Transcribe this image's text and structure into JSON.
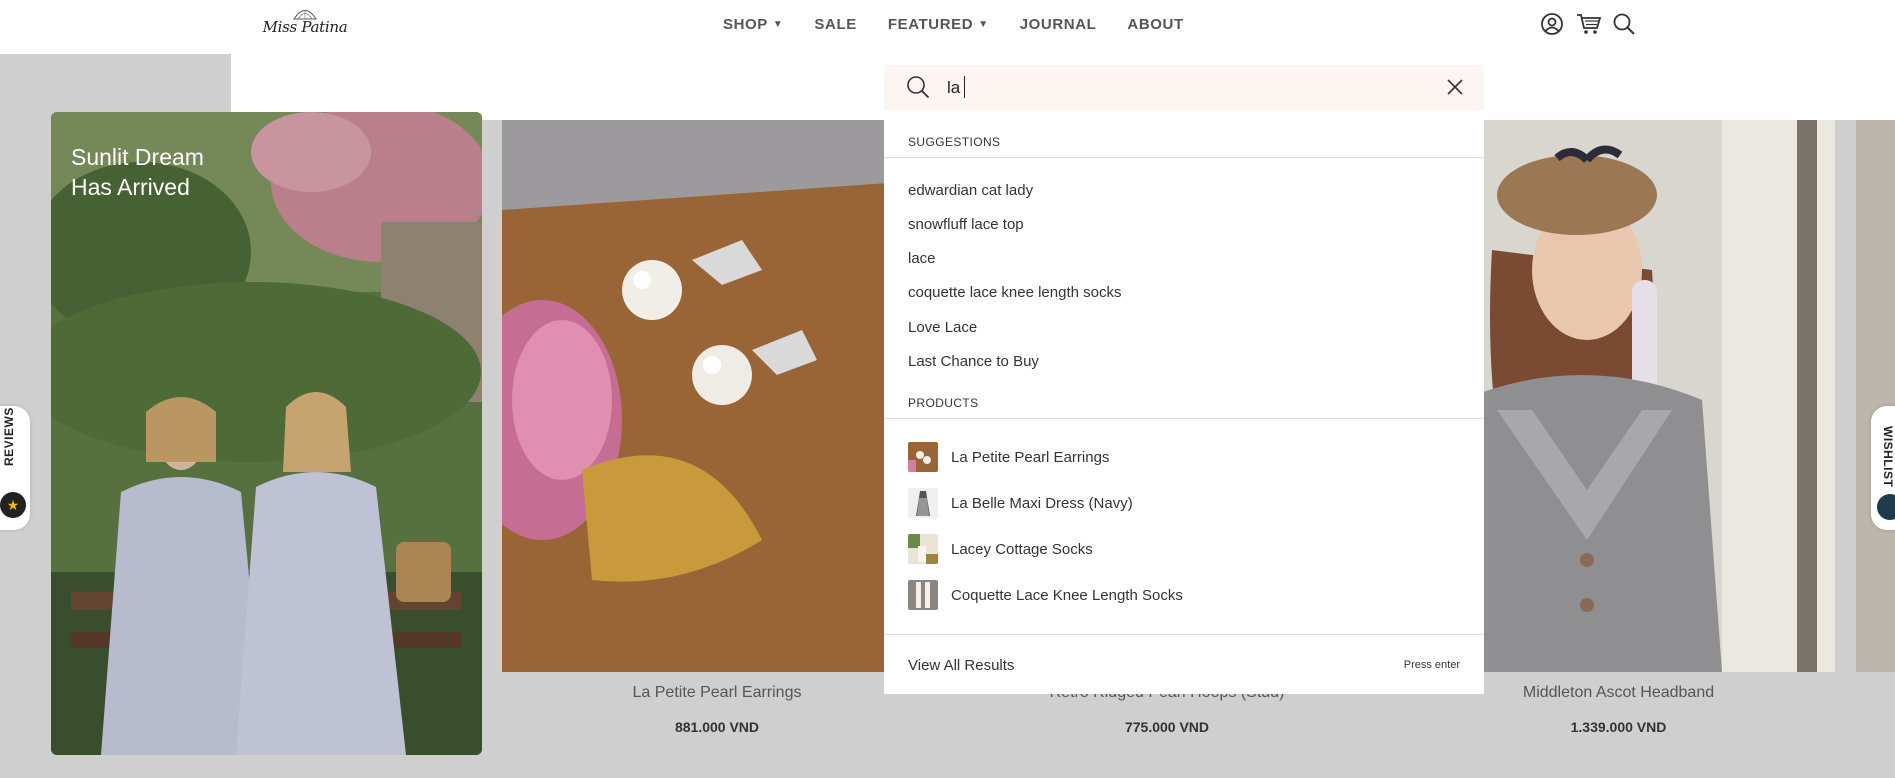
{
  "header": {
    "logo_text": "Miss Patina",
    "nav": [
      {
        "label": "SHOP",
        "has_caret": true
      },
      {
        "label": "SALE",
        "has_caret": false
      },
      {
        "label": "FEATURED",
        "has_caret": true
      },
      {
        "label": "JOURNAL",
        "has_caret": false
      },
      {
        "label": "ABOUT",
        "has_caret": false
      }
    ],
    "icons": [
      "account-icon",
      "cart-icon",
      "search-icon"
    ]
  },
  "hero": {
    "line1": "Sunlit Dream",
    "line2": "Has Arrived"
  },
  "products": [
    {
      "name": "La Petite Pearl Earrings",
      "price": "881.000 VND"
    },
    {
      "name": "Retro Ridged Pearl Hoops (Stud)",
      "price": "775.000 VND"
    },
    {
      "name": "Middleton Ascot Headband",
      "price": "1.339.000 VND"
    }
  ],
  "search": {
    "query": "la",
    "suggestions_heading": "SUGGESTIONS",
    "suggestions": [
      "edwardian cat lady",
      "snowfluff lace top",
      "lace",
      "coquette lace knee length socks",
      "Love Lace",
      "Last Chance to Buy"
    ],
    "products_heading": "PRODUCTS",
    "products": [
      "La Petite Pearl Earrings",
      "La Belle Maxi Dress (Navy)",
      "Lacey Cottage Socks",
      "Coquette Lace Knee Length Socks"
    ],
    "view_all": "View All Results",
    "press_enter": "Press enter"
  },
  "side_tabs": {
    "reviews": "REVIEWS",
    "wishlist": "WISHLIST"
  },
  "colors": {
    "page_bg": "#cfcfcf",
    "search_bg": "#fdf5f1",
    "star": "#f5b800"
  }
}
